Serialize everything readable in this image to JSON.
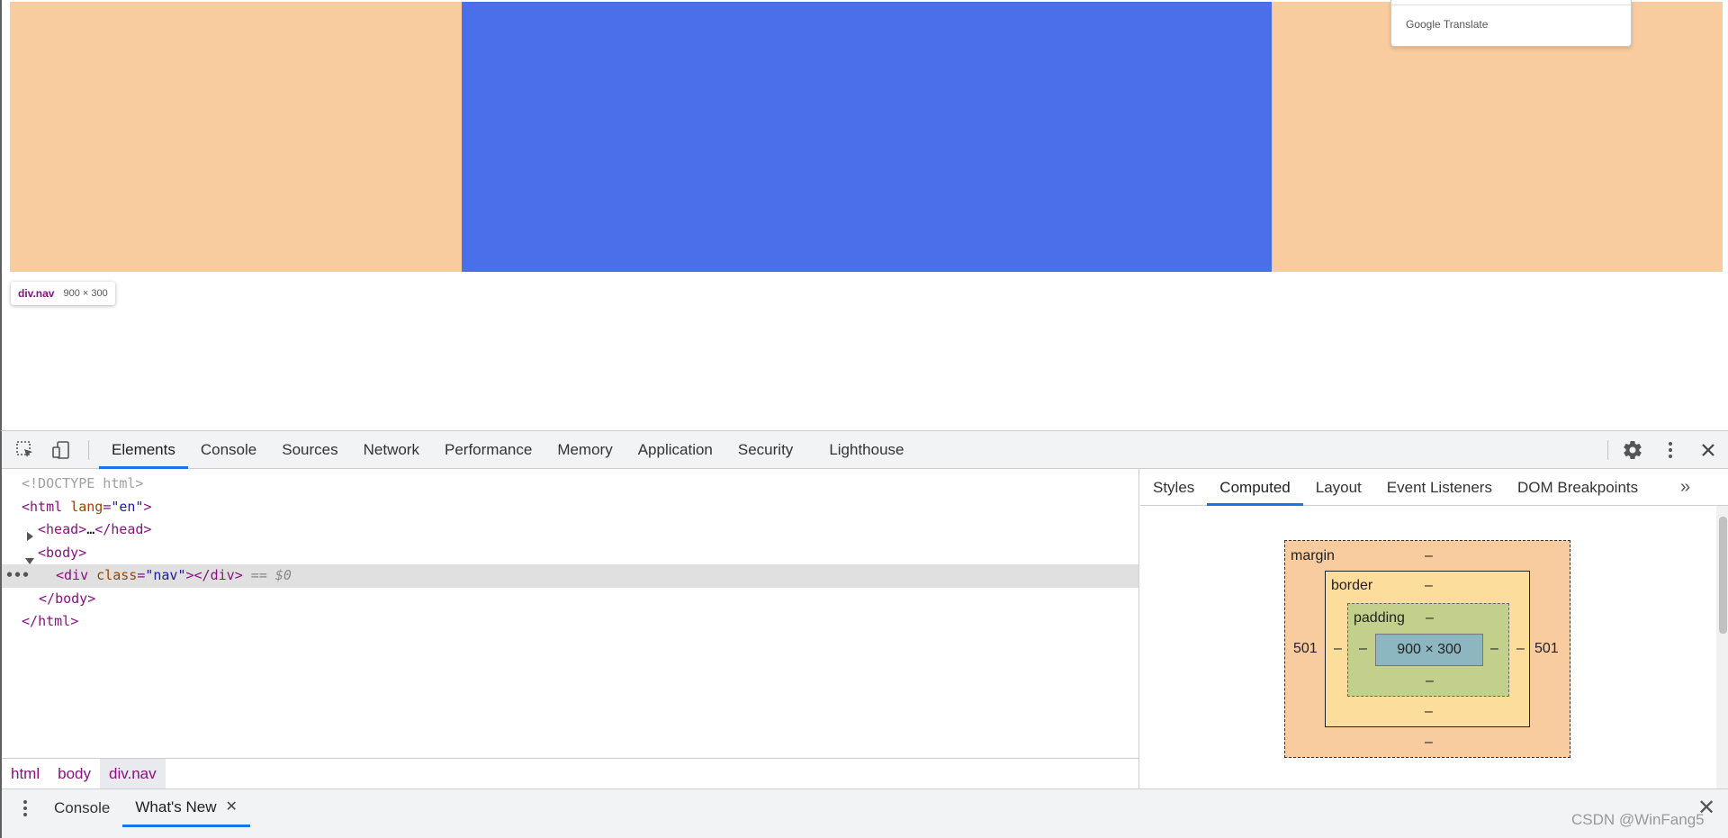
{
  "viewport": {
    "tooltip_tag": "div.nav",
    "tooltip_size": "900 × 300",
    "translate_brand": "Google Translate"
  },
  "toolbar": {
    "tabs": [
      "Elements",
      "Console",
      "Sources",
      "Network",
      "Performance",
      "Memory",
      "Application",
      "Security",
      "Lighthouse"
    ],
    "active_tab": "Elements",
    "icons": [
      "inspect-element-icon",
      "device-toolbar-icon",
      "gear-icon",
      "more-vertical-icon",
      "close-icon"
    ]
  },
  "dom": {
    "doctype": "<!DOCTYPE html>",
    "html_open_tag": "html",
    "html_attr": "lang",
    "html_attr_val": "\"en\"",
    "head_collapsed": "…",
    "head_tag": "head",
    "body_tag": "body",
    "div_tag": "div",
    "div_attr": "class",
    "div_attr_val": "\"nav\"",
    "selected_marker": "== $0",
    "ellipsis": "•••"
  },
  "breadcrumbs": [
    "html",
    "body",
    "div.nav"
  ],
  "sidebar": {
    "tabs": [
      "Styles",
      "Computed",
      "Layout",
      "Event Listeners",
      "DOM Breakpoints"
    ],
    "active_tab": "Computed",
    "more": "»"
  },
  "box_model": {
    "margin_label": "margin",
    "border_label": "border",
    "padding_label": "padding",
    "content": "900 × 300",
    "margin_left": "501",
    "margin_right": "501",
    "dash": "–"
  },
  "drawer": {
    "tabs": [
      "Console",
      "What's New"
    ],
    "active_tab": "What's New",
    "close_tab": "✕",
    "close_drawer": "✕"
  },
  "watermark": "CSDN @WinFang5",
  "colors": {
    "margin": "#f8cc9e",
    "element": "#4a6fe8",
    "border": "#fddd9b",
    "padding": "#c3d08b",
    "content": "#8cb6c0",
    "accent": "#1a73e8"
  }
}
